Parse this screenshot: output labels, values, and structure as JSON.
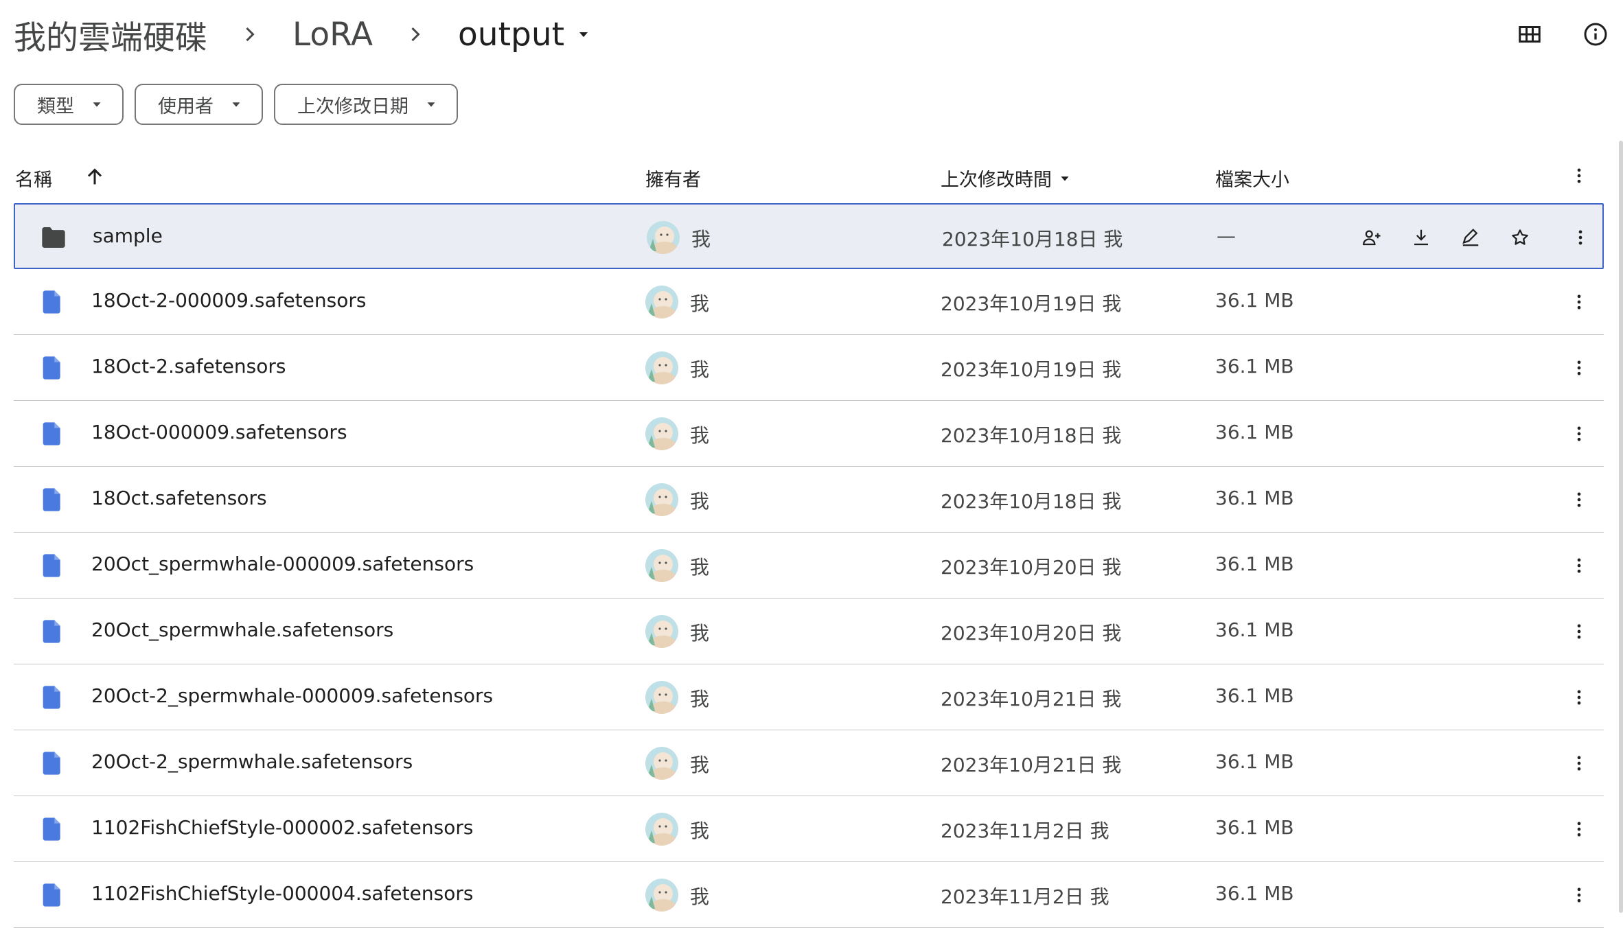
{
  "breadcrumb": {
    "root": "我的雲端硬碟",
    "parent": "LoRA",
    "current": "output"
  },
  "header_icons": [
    "grid-view-icon",
    "info-icon"
  ],
  "filters": [
    {
      "label": "類型"
    },
    {
      "label": "使用者"
    },
    {
      "label": "上次修改日期"
    }
  ],
  "columns": {
    "name": "名稱",
    "owner": "擁有者",
    "modified": "上次修改時間",
    "size": "檔案大小"
  },
  "rows": [
    {
      "name": "sample",
      "type": "folder",
      "owner": "我",
      "modified": "2023年10月18日 我",
      "size": "—",
      "selected": true
    },
    {
      "name": "18Oct-2-000009.safetensors",
      "type": "file",
      "owner": "我",
      "modified": "2023年10月19日 我",
      "size": "36.1 MB"
    },
    {
      "name": "18Oct-2.safetensors",
      "type": "file",
      "owner": "我",
      "modified": "2023年10月19日 我",
      "size": "36.1 MB"
    },
    {
      "name": "18Oct-000009.safetensors",
      "type": "file",
      "owner": "我",
      "modified": "2023年10月18日 我",
      "size": "36.1 MB"
    },
    {
      "name": "18Oct.safetensors",
      "type": "file",
      "owner": "我",
      "modified": "2023年10月18日 我",
      "size": "36.1 MB"
    },
    {
      "name": "20Oct_spermwhale-000009.safetensors",
      "type": "file",
      "owner": "我",
      "modified": "2023年10月20日 我",
      "size": "36.1 MB"
    },
    {
      "name": "20Oct_spermwhale.safetensors",
      "type": "file",
      "owner": "我",
      "modified": "2023年10月20日 我",
      "size": "36.1 MB"
    },
    {
      "name": "20Oct-2_spermwhale-000009.safetensors",
      "type": "file",
      "owner": "我",
      "modified": "2023年10月21日 我",
      "size": "36.1 MB"
    },
    {
      "name": "20Oct-2_spermwhale.safetensors",
      "type": "file",
      "owner": "我",
      "modified": "2023年10月21日 我",
      "size": "36.1 MB"
    },
    {
      "name": "1102FishChiefStyle-000002.safetensors",
      "type": "file",
      "owner": "我",
      "modified": "2023年11月2日 我",
      "size": "36.1 MB"
    },
    {
      "name": "1102FishChiefStyle-000004.safetensors",
      "type": "file",
      "owner": "我",
      "modified": "2023年11月2日 我",
      "size": "36.1 MB"
    }
  ],
  "selected_row_actions": [
    "share-icon",
    "download-icon",
    "rename-icon",
    "star-icon"
  ],
  "colors": {
    "file_icon": "#4a7ae0",
    "folder_icon": "#444746",
    "selection_border": "#3d63c9",
    "selection_bg": "#eaeef4"
  }
}
